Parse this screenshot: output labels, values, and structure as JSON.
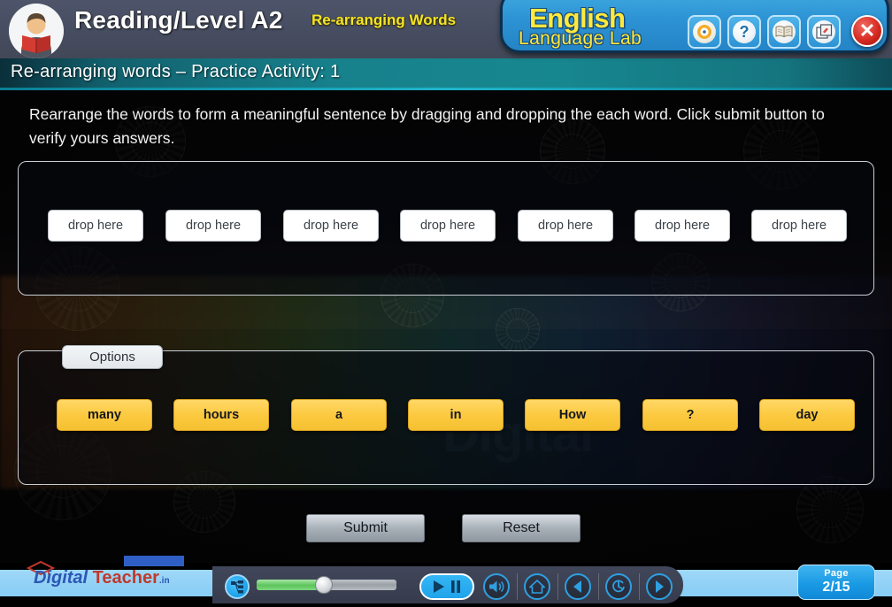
{
  "header": {
    "title": "Reading/Level A2",
    "subtitle": "Re-arranging Words",
    "avatar_name": "student-reading-avatar",
    "brand_line1": "English",
    "brand_line2": "Language Lab",
    "icons": [
      {
        "name": "record-disc-icon",
        "glyph": "◉"
      },
      {
        "name": "help-question-icon",
        "glyph": "?"
      },
      {
        "name": "dictionary-book-icon",
        "glyph": "📖"
      },
      {
        "name": "window-copy-icon",
        "glyph": "⧉"
      }
    ],
    "close_label": "✕"
  },
  "subbar": {
    "text": "Re-arranging words – Practice Activity: 1"
  },
  "main": {
    "instruction": "Rearrange the words to form a meaningful sentence by dragging and dropping the each word. Click submit button to verify yours answers.",
    "watermark": "Digital",
    "dropzone_placeholder": "drop here",
    "dropzones": [
      {
        "label": "drop here"
      },
      {
        "label": "drop here"
      },
      {
        "label": "drop here"
      },
      {
        "label": "drop here"
      },
      {
        "label": "drop here"
      },
      {
        "label": "drop here"
      },
      {
        "label": "drop here"
      }
    ],
    "options_tab_label": "Options",
    "words": [
      {
        "label": "many"
      },
      {
        "label": "hours"
      },
      {
        "label": "a"
      },
      {
        "label": "in"
      },
      {
        "label": "How"
      },
      {
        "label": "?"
      },
      {
        "label": "day"
      }
    ],
    "submit_label": "Submit",
    "reset_label": "Reset"
  },
  "bottom": {
    "logo_d": "Digital",
    "logo_t": " Teacher",
    "logo_in": ".in",
    "progress_percent": 47,
    "controls": [
      {
        "name": "index-tree-icon"
      },
      {
        "name": "progress-slider"
      },
      {
        "name": "play-pause-button"
      },
      {
        "name": "volume-icon"
      },
      {
        "name": "home-icon"
      },
      {
        "name": "previous-icon"
      },
      {
        "name": "refresh-icon"
      },
      {
        "name": "next-icon"
      }
    ],
    "page_label": "Page",
    "page_value": "2/15"
  },
  "colors": {
    "accent_yellow": "#fcc93f",
    "brand_blue": "#2d93d4",
    "teal_bar": "#17818c",
    "header_slate": "#474d61",
    "close_red": "#d62b22"
  }
}
